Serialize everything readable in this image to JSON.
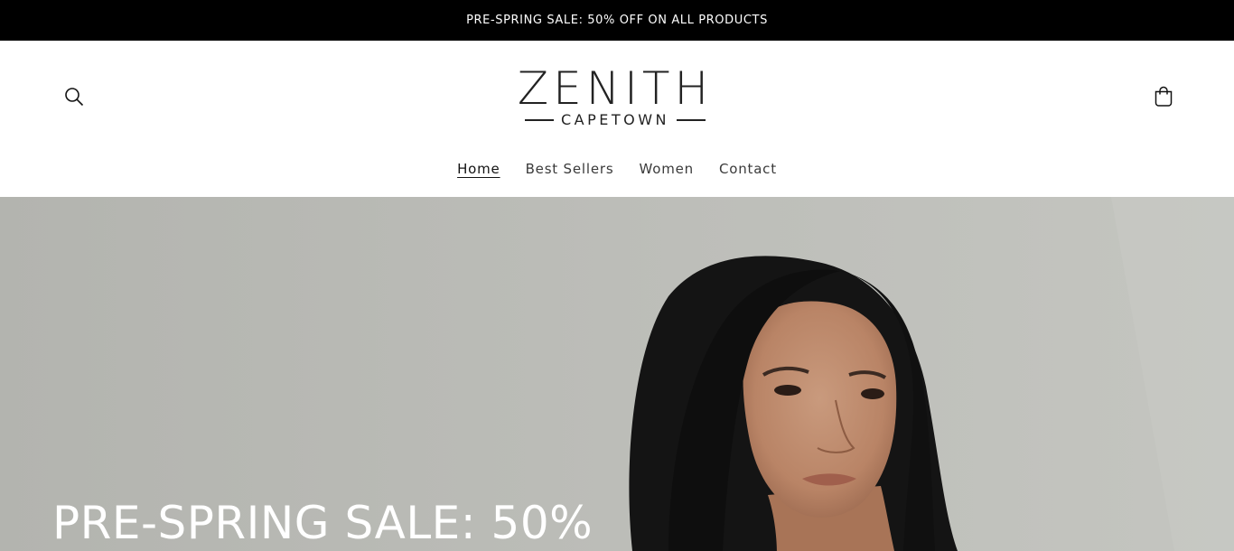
{
  "announcement": {
    "text": "PRE-SPRING SALE: 50% OFF ON ALL PRODUCTS"
  },
  "header": {
    "logo": {
      "name": "ZENITH",
      "location": "CAPETOWN"
    },
    "icons": {
      "search": "search-icon",
      "cart": "cart-icon"
    }
  },
  "nav": {
    "items": [
      {
        "label": "Home",
        "active": true
      },
      {
        "label": "Best Sellers",
        "active": false
      },
      {
        "label": "Women",
        "active": false
      },
      {
        "label": "Contact",
        "active": false
      }
    ]
  },
  "hero": {
    "title": "PRE-SPRING SALE: 50%",
    "image": "woman-portrait-photo"
  },
  "colors": {
    "announcement_bg": "#000000",
    "hero_bg": "#b6b7b2",
    "text": "#121212"
  }
}
